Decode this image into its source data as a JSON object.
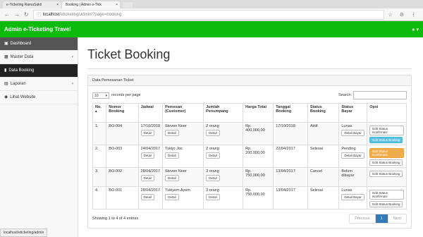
{
  "browser": {
    "tabs": [
      {
        "label": "e-Ticketing RamaSakti",
        "close": "×"
      },
      {
        "label": "Booking | Admin e-Tick",
        "close": "×"
      }
    ],
    "url_host": "localhost",
    "url_path": "/eticketing/admin/?page=booking"
  },
  "navbar": {
    "brand": "Admin e-Ticketing Travel",
    "user_icon": "user-icon",
    "user_caret": "▾"
  },
  "sidebar": {
    "items": [
      {
        "icon": "dashboard-icon",
        "label": "Dashboard",
        "caret": ""
      },
      {
        "icon": "grid-icon",
        "label": "Master Data",
        "caret": "‹"
      },
      {
        "icon": "chart-icon",
        "label": "Data Booking",
        "caret": ""
      },
      {
        "icon": "file-icon",
        "label": "Laporan",
        "caret": "‹"
      },
      {
        "icon": "eye-icon",
        "label": "Lihat Website",
        "caret": ""
      }
    ]
  },
  "page": {
    "title": "Ticket Booking",
    "panel_title": "Data Pemesanan Ticket",
    "length_value": "10",
    "length_label": "records per page",
    "search_label": "Search:",
    "info": "Showing 1 to 4 of 4 entries",
    "pager": {
      "prev": "Previous",
      "current": "1",
      "next": "Next"
    }
  },
  "table": {
    "headers": [
      "No.",
      "Nomor Booking",
      "Jadwal",
      "Pemesan (Customer)",
      "Jumlah Penumpang",
      "Harga Total",
      "Tanggal Booking",
      "Status Booking",
      "Status Bayar",
      "Opsi"
    ],
    "detail_label": "Detail",
    "rows": [
      {
        "no": "1.",
        "nomor": "BO-004",
        "jadwal": "17/10/2018",
        "pemesan": "Steven Noor",
        "jumlah": "2 orang",
        "harga": "Rp. 400.000,00",
        "tanggal": "17/10/2018",
        "status": "Aktif",
        "bayar": "Lunas",
        "bayar_btn": "Detail Bayar",
        "opsi": [
          {
            "label": "Edit Status Konfirmasi",
            "style": ""
          },
          {
            "label": "Edit Status Booking",
            "style": "info"
          }
        ]
      },
      {
        "no": "2.",
        "nomor": "BO-003",
        "jadwal": "24/04/2017",
        "pemesan": "Tukijo Jos",
        "jumlah": "2 orang",
        "harga": "Rp. 200.000,00",
        "tanggal": "22/04/2017",
        "status": "Selesai",
        "bayar": "Pending",
        "bayar_btn": "Detail Bayar",
        "opsi": [
          {
            "label": "Edit Status Konfirmasi",
            "style": "warning"
          },
          {
            "label": "Edit Status Booking",
            "style": ""
          }
        ]
      },
      {
        "no": "3.",
        "nomor": "BO-002",
        "jadwal": "28/04/2017",
        "pemesan": "Steven Noor",
        "jumlah": "3 orang",
        "harga": "Rp. 750.000,00",
        "tanggal": "13/04/2017",
        "status": "Cancel",
        "bayar": "Belum dibayar",
        "bayar_btn": "",
        "opsi": [
          {
            "label": "Edit Status Booking",
            "style": ""
          }
        ]
      },
      {
        "no": "4.",
        "nomor": "BO-001",
        "jadwal": "28/04/2017",
        "pemesan": "Tukiyem Ayem",
        "jumlah": "3 orang",
        "harga": "Rp. 750.000,00",
        "tanggal": "13/04/2017",
        "status": "Selesai",
        "bayar": "Lunas",
        "bayar_btn": "Detail Bayar",
        "opsi": [
          {
            "label": "Edit Status Konfirmasi",
            "style": ""
          },
          {
            "label": "Edit Status Booking",
            "style": ""
          }
        ]
      }
    ]
  },
  "statusbar": "localhost/eticketing/admin"
}
